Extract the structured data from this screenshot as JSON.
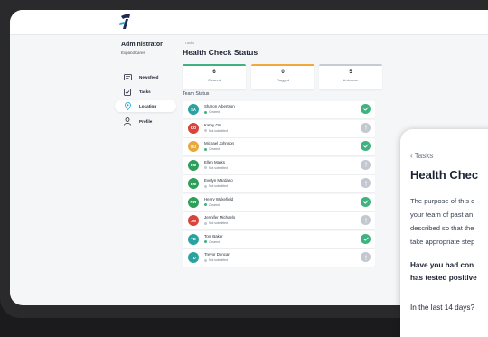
{
  "sidebar": {
    "user_name": "Administrator",
    "org": "ExpandCares",
    "items": [
      {
        "label": "Newsfeed",
        "icon": "newsfeed-icon",
        "active": false
      },
      {
        "label": "Tasks",
        "icon": "tasks-checkbox-icon",
        "active": false
      },
      {
        "label": "Location",
        "icon": "location-pin-icon",
        "active": true
      },
      {
        "label": "Profile",
        "icon": "user-icon",
        "active": false
      }
    ]
  },
  "main": {
    "breadcrumb": "‹ Tasks",
    "title": "Health Check Status",
    "stats": [
      {
        "value": "6",
        "label": "Cleared",
        "color": "#3fb27f"
      },
      {
        "value": "0",
        "label": "Flagged",
        "color": "#f2a93b"
      },
      {
        "value": "5",
        "label": "Unknown",
        "color": "#c7ccd4"
      }
    ],
    "section_label": "Team Status",
    "team": [
      {
        "initials": "SA",
        "name": "Sharon Albertson",
        "status": "Cleared",
        "avatar_color": "#2aa3a0",
        "state": "cleared"
      },
      {
        "initials": "KO",
        "name": "Kathy Orr",
        "status": "Not submitted",
        "avatar_color": "#d9433b",
        "state": "unknown"
      },
      {
        "initials": "MJ",
        "name": "Michael Johnson",
        "status": "Cleared",
        "avatar_color": "#e8a93b",
        "state": "cleared"
      },
      {
        "initials": "EM",
        "name": "Ellen Marks",
        "status": "Not submitted",
        "avatar_color": "#2e9f5b",
        "state": "unknown"
      },
      {
        "initials": "EM",
        "name": "Evelyn Mardano",
        "status": "Not submitted",
        "avatar_color": "#2e9f5b",
        "state": "unknown"
      },
      {
        "initials": "HW",
        "name": "Henry Wakefield",
        "status": "Cleared",
        "avatar_color": "#2e9f5b",
        "state": "cleared"
      },
      {
        "initials": "JM",
        "name": "Jennifer Michaels",
        "status": "Not submitted",
        "avatar_color": "#d9433b",
        "state": "unknown"
      },
      {
        "initials": "TB",
        "name": "Toni Baker",
        "status": "Cleared",
        "avatar_color": "#2aa3a0",
        "state": "cleared"
      },
      {
        "initials": "TD",
        "name": "Trevor Duncan",
        "status": "Not submitted",
        "avatar_color": "#2aa3a0",
        "state": "unknown"
      }
    ]
  },
  "phone": {
    "breadcrumb": "‹ Tasks",
    "title": "Health Chec",
    "body_lines": [
      "The purpose of this c",
      "your team of past an",
      "described so that the",
      "take appropriate step"
    ],
    "question_lines": [
      "Have you had con",
      "has tested positive"
    ],
    "subquestion": "In the last 14 days?"
  },
  "colors": {
    "cleared": "#3fb27f",
    "unknown": "#c3c8d0",
    "flagged": "#f2a93b"
  }
}
